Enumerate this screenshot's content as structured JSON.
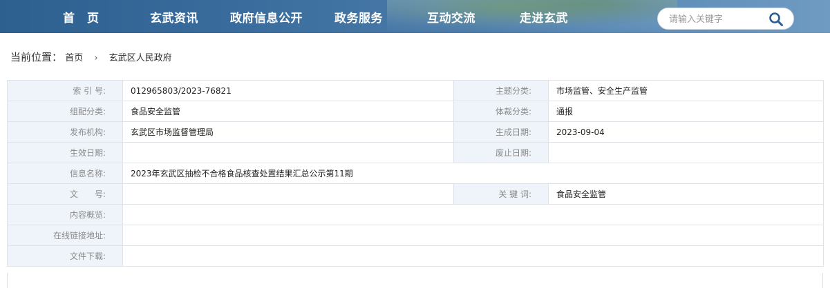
{
  "nav": {
    "items": [
      {
        "label": "首　页"
      },
      {
        "label": "玄武资讯"
      },
      {
        "label": "政府信息公开"
      },
      {
        "label": "政务服务"
      },
      {
        "label": "互动交流"
      },
      {
        "label": "走进玄武"
      }
    ],
    "search_placeholder": "请输入关键字",
    "search_icon": "search-icon"
  },
  "breadcrumb": {
    "lead": "当前位置：",
    "items": [
      "首页",
      "玄武区人民政府"
    ],
    "separator": "›"
  },
  "meta": {
    "index_no_label": "索 引 号:",
    "index_no": "012965803/2023-76821",
    "topic_label": "主题分类:",
    "topic": "市场监管、安全生产监管",
    "config_label": "组配分类:",
    "config": "食品安全监管",
    "genre_label": "体裁分类:",
    "genre": "通报",
    "publisher_label": "发布机构:",
    "publisher": "玄武区市场监督管理局",
    "created_label": "生成日期:",
    "created": "2023-09-04",
    "effective_label": "生效日期:",
    "effective": "",
    "abolish_label": "废止日期:",
    "abolish": "",
    "name_label": "信息名称:",
    "name": "2023年玄武区抽检不合格食品核查处置结果汇总公示第11期",
    "docno_label": "文　　号:",
    "docno": "",
    "keywords_label": "关 键 词:",
    "keywords": "食品安全监管",
    "summary_label": "内容概览:",
    "summary": "",
    "link_label": "在线链接地址:",
    "link": "",
    "download_label": "文件下载:",
    "download": ""
  }
}
